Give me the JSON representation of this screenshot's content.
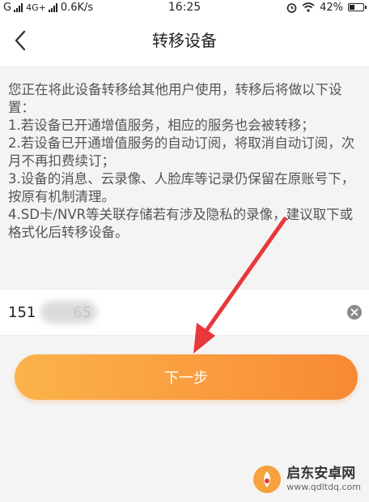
{
  "status_bar": {
    "carrier": "G",
    "network": "4G+",
    "speed": "0.6K/s",
    "time": "16:25",
    "battery": "42%",
    "battery_level": 0.42
  },
  "header": {
    "title": "转移设备"
  },
  "description": {
    "lines": [
      "您正在将此设备转移给其他用户使用，转移后将做以下设置：",
      "1.若设备已开通增值服务，相应的服务也会被转移；",
      "2.若设备已开通增值服务的自动订阅，将取消自动订阅，次月不再扣费续订；",
      "3.设备的消息、云录像、人脸库等记录仍保留在原账号下，按原有机制清理。",
      "4.SD卡/NVR等关联存储若有涉及隐私的录像，建议取下或格式化后转移设备。"
    ]
  },
  "phone_field": {
    "value": "151        65"
  },
  "next_button": {
    "label": "下一步"
  },
  "colors": {
    "button_start": "#fbb34a",
    "button_end": "#f88a34",
    "arrow": "#e8383d"
  },
  "watermark": {
    "name": "启东安卓网",
    "url": "www.qdltdq.com"
  }
}
